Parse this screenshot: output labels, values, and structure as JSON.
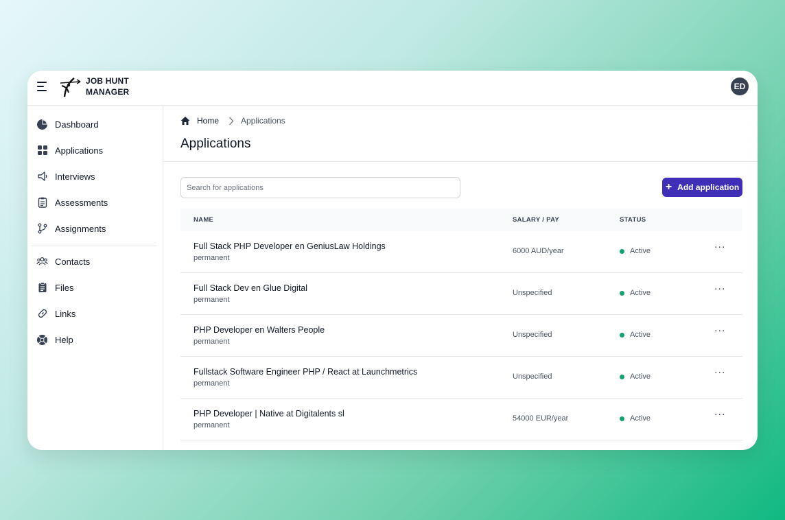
{
  "app": {
    "brand_line1": "JOB HUNT",
    "brand_line2": "MANAGER",
    "user_initials": "ED"
  },
  "sidebar": {
    "items": [
      {
        "label": "Dashboard",
        "icon": "pie-chart-icon"
      },
      {
        "label": "Applications",
        "icon": "grid-icon"
      },
      {
        "label": "Interviews",
        "icon": "megaphone-icon"
      },
      {
        "label": "Assessments",
        "icon": "clipboard-list-icon"
      },
      {
        "label": "Assignments",
        "icon": "git-branch-icon"
      }
    ],
    "items2": [
      {
        "label": "Contacts",
        "icon": "users-icon"
      },
      {
        "label": "Files",
        "icon": "clipboard-icon"
      },
      {
        "label": "Links",
        "icon": "link-icon"
      },
      {
        "label": "Help",
        "icon": "lifebuoy-icon"
      }
    ]
  },
  "breadcrumb": {
    "home": "Home",
    "current": "Applications"
  },
  "page": {
    "title": "Applications"
  },
  "search": {
    "placeholder": "Search for applications",
    "value": ""
  },
  "actions": {
    "add_label": "Add application"
  },
  "table": {
    "headers": {
      "name": "NAME",
      "salary": "SALARY / PAY",
      "status": "STATUS"
    },
    "rows": [
      {
        "title": "Full Stack PHP Developer en GeniusLaw Holdings",
        "type": "permanent",
        "salary": "6000 AUD/year",
        "status": "Active"
      },
      {
        "title": "Full Stack Dev en Glue Digital",
        "type": "permanent",
        "salary": "Unspecified",
        "status": "Active"
      },
      {
        "title": "PHP Developer en Walters People",
        "type": "permanent",
        "salary": "Unspecified",
        "status": "Active"
      },
      {
        "title": "Fullstack Software Engineer PHP / React at Launchmetrics",
        "type": "permanent",
        "salary": "Unspecified",
        "status": "Active"
      },
      {
        "title": "PHP Developer | Native at Digitalents sl",
        "type": "permanent",
        "salary": "54000 EUR/year",
        "status": "Active"
      }
    ],
    "more_symbol": "···"
  },
  "colors": {
    "accent": "#3f2fb8",
    "active_dot": "#10a36e",
    "avatar_bg": "#374151"
  }
}
